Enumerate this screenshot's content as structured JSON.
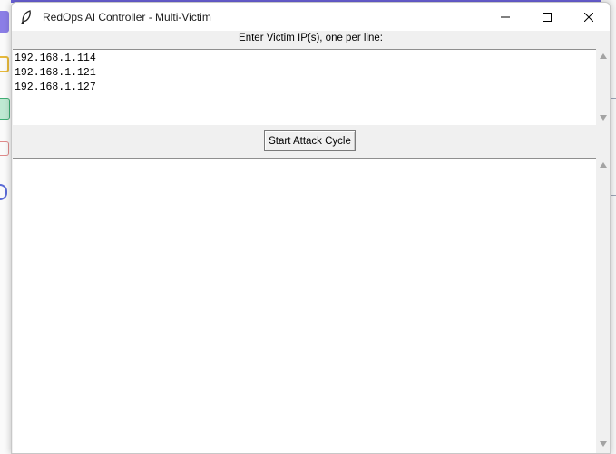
{
  "window": {
    "title": "RedOps AI Controller - Multi-Victim",
    "controls": [
      "minimize",
      "maximize",
      "close"
    ],
    "icon": "feather-icon"
  },
  "input_section": {
    "label": "Enter Victim IP(s), one per line:",
    "ip_lines": [
      "192.168.1.114",
      "192.168.1.121",
      "192.168.1.127"
    ]
  },
  "actions": {
    "start_label": "Start Attack Cycle"
  },
  "output": {
    "text": ""
  },
  "colors": {
    "desktop_accent": "#6b62d9",
    "window_bg": "#f0f0f0",
    "text_area_bg": "#ffffff"
  }
}
